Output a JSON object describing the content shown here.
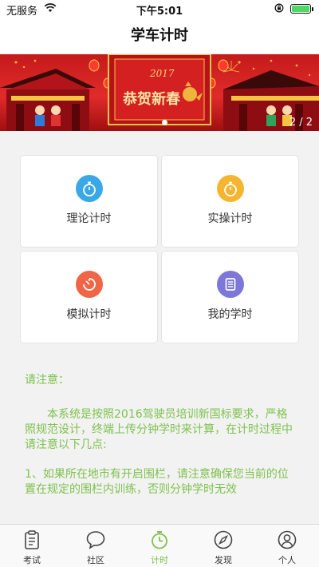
{
  "status_bar": {
    "carrier": "无服务",
    "time": "下午5:01"
  },
  "nav": {
    "title": "学车计时"
  },
  "banner": {
    "counter": "2 / 2",
    "year_text": "2017",
    "greeting_text": "恭贺新春"
  },
  "menu": [
    {
      "label": "理论计时",
      "icon": "stopwatch-icon",
      "color": "#3aa8e6"
    },
    {
      "label": "实操计时",
      "icon": "stopwatch-icon",
      "color": "#f5b530"
    },
    {
      "label": "模拟计时",
      "icon": "timer-icon",
      "color": "#f06545"
    },
    {
      "label": "我的学时",
      "icon": "document-icon",
      "color": "#7c77d8"
    }
  ],
  "notice": {
    "heading": "请注意：",
    "paragraph": "本系统是按照2016驾驶员培训新国标要求，严格照规范设计，终端上传分钟学时来计算，在计时过程中请注意以下几点:",
    "item1": "1、如果所在地市有开启围栏，请注意确保您当前的位置在规定的围栏内训练，否则分钟学时无效"
  },
  "tabs": [
    {
      "label": "考试",
      "icon": "clipboard-icon"
    },
    {
      "label": "社区",
      "icon": "chat-bubble-icon"
    },
    {
      "label": "计时",
      "icon": "stopwatch-icon",
      "active": true
    },
    {
      "label": "发现",
      "icon": "compass-icon"
    },
    {
      "label": "个人",
      "icon": "person-icon"
    }
  ],
  "colors": {
    "accent": "#7ec24e",
    "banner_red": "#d42020"
  }
}
